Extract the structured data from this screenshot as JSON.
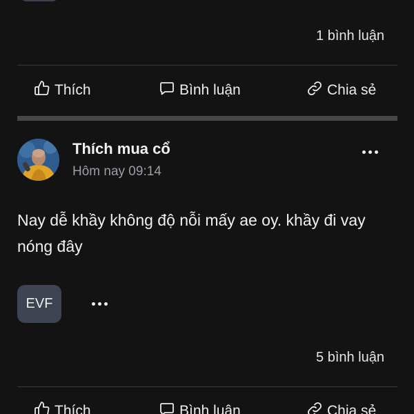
{
  "prev_post": {
    "comment_count": "1 bình luận",
    "actions": {
      "like": "Thích",
      "comment": "Bình luận",
      "share": "Chia sẻ"
    }
  },
  "post": {
    "author": "Thích mua cổ",
    "time": "Hôm nay 09:14",
    "body": "Nay dễ khầy không độ nỗi mấy ae oy. khầy đi vay nóng đây",
    "tag": "EVF",
    "comment_count": "5 bình luận",
    "actions": {
      "like": "Thích",
      "comment": "Bình luận",
      "share": "Chia sẻ"
    }
  },
  "colors": {
    "background": "#131313",
    "tag_chip": "#3e4452",
    "muted_text": "#9a9ea6",
    "separator": "#444648"
  },
  "icons": {
    "like": "thumbs-up-icon",
    "comment": "comment-bubble-icon",
    "share": "link-icon",
    "more": "ellipsis-icon"
  }
}
